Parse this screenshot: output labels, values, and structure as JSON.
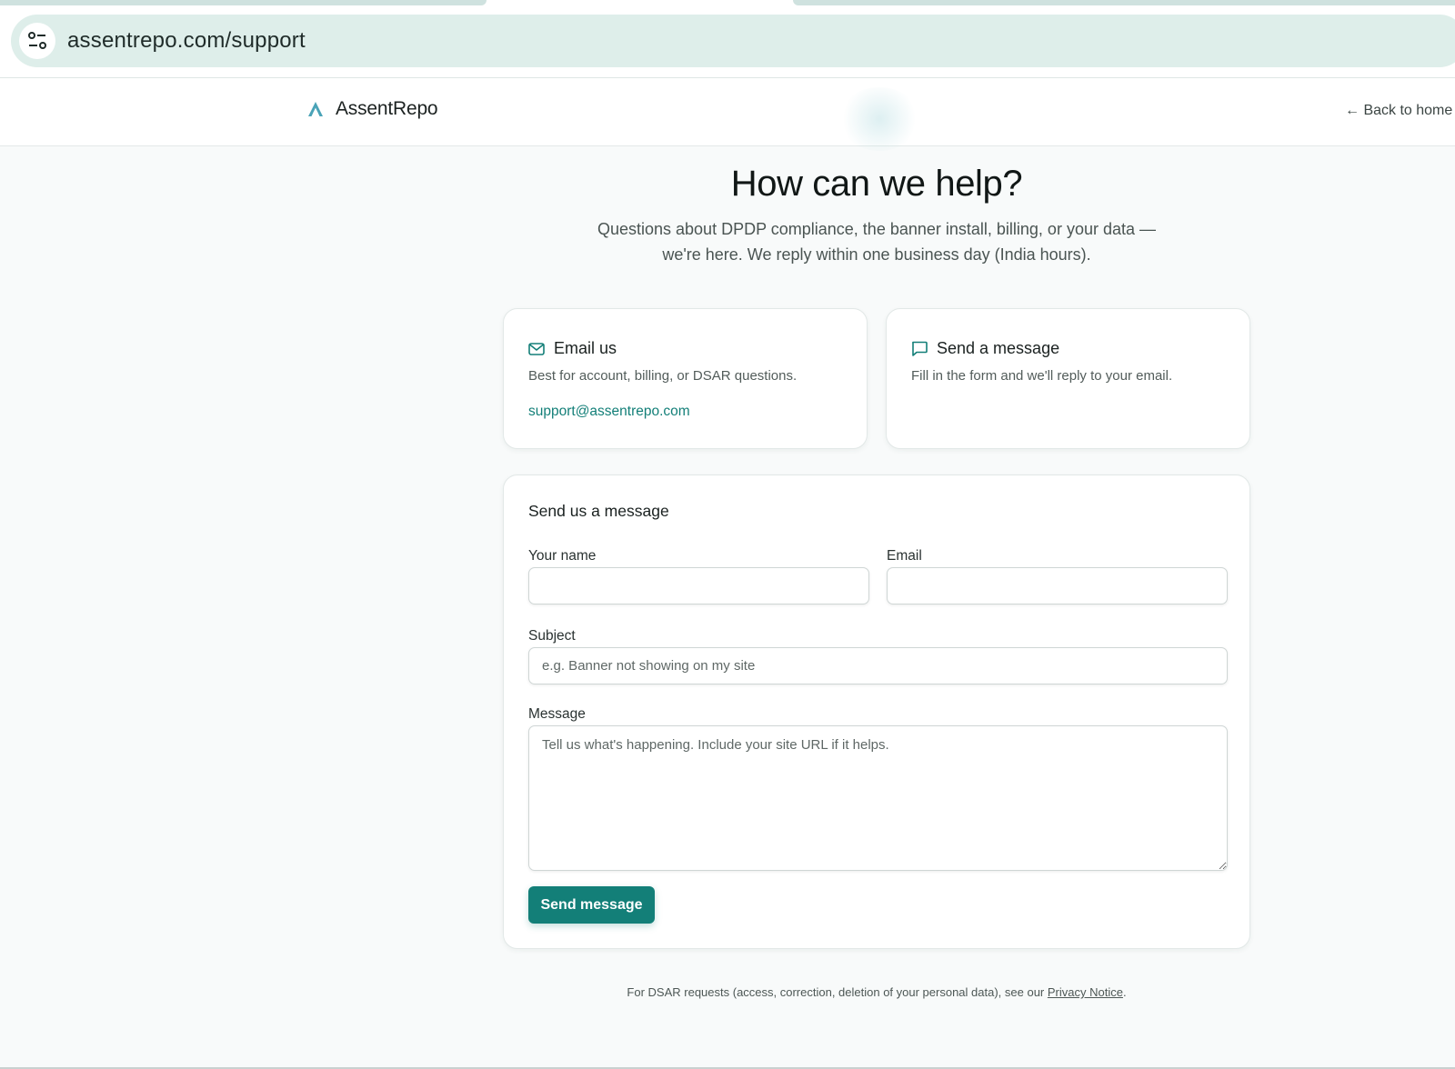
{
  "browser": {
    "url": "assentrepo.com/support"
  },
  "header": {
    "brand_name": "AssentRepo",
    "back_link": "← Back to home"
  },
  "hero": {
    "title": "How can we help?",
    "subtitle": "Questions about DPDP compliance, the banner install, billing, or your data — we're here. We reply within one business day (India hours)."
  },
  "cards": {
    "email": {
      "title": "Email us",
      "description": "Best for account, billing, or DSAR questions.",
      "address": "support@assentrepo.com",
      "icon": "mail-icon"
    },
    "message": {
      "title": "Send a message",
      "description": "Fill in the form and we'll reply to your email.",
      "icon": "chat-icon"
    }
  },
  "form": {
    "title": "Send us a message",
    "name_label": "Your name",
    "name_value": "",
    "email_label": "Email",
    "email_value": "",
    "subject_label": "Subject",
    "subject_placeholder": "e.g. Banner not showing on my site",
    "message_label": "Message",
    "message_placeholder": "Tell us what's happening. Include your site URL if it helps.",
    "submit_label": "Send message"
  },
  "footer": {
    "note_prefix": "For DSAR requests (access, correction, deletion of your personal data), see our ",
    "privacy_link": "Privacy Notice",
    "note_suffix": "."
  },
  "colors": {
    "accent": "#137f78",
    "address_bar": "#deeeea",
    "background": "#f8fafa"
  }
}
